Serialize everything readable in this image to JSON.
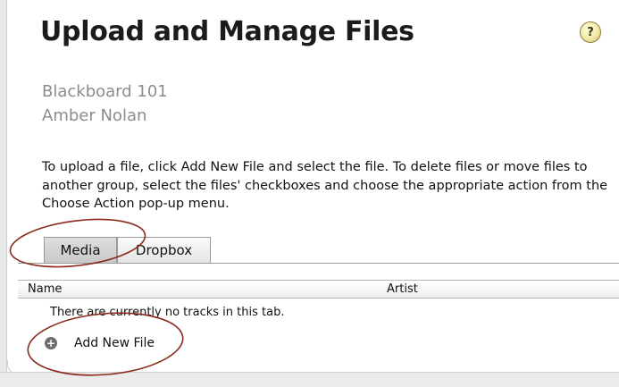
{
  "page": {
    "title": "Upload and Manage Files",
    "help_glyph": "?",
    "course": "Blackboard 101",
    "user": "Amber Nolan",
    "instructions": "To upload a file, click Add New File and select the file. To delete files or move files to another group, select the files' checkboxes and choose the appropriate action from the Choose Action pop-up menu."
  },
  "tabs": [
    {
      "label": "Media",
      "selected": true
    },
    {
      "label": "Dropbox",
      "selected": false
    }
  ],
  "table": {
    "columns": [
      "Name",
      "Artist"
    ],
    "empty_message": "There are currently no tracks in this tab."
  },
  "actions": {
    "add_new_file_label": "Add New File",
    "add_icon_glyph": "+"
  },
  "annotations": {
    "circle_color": "#8a2a1e"
  }
}
